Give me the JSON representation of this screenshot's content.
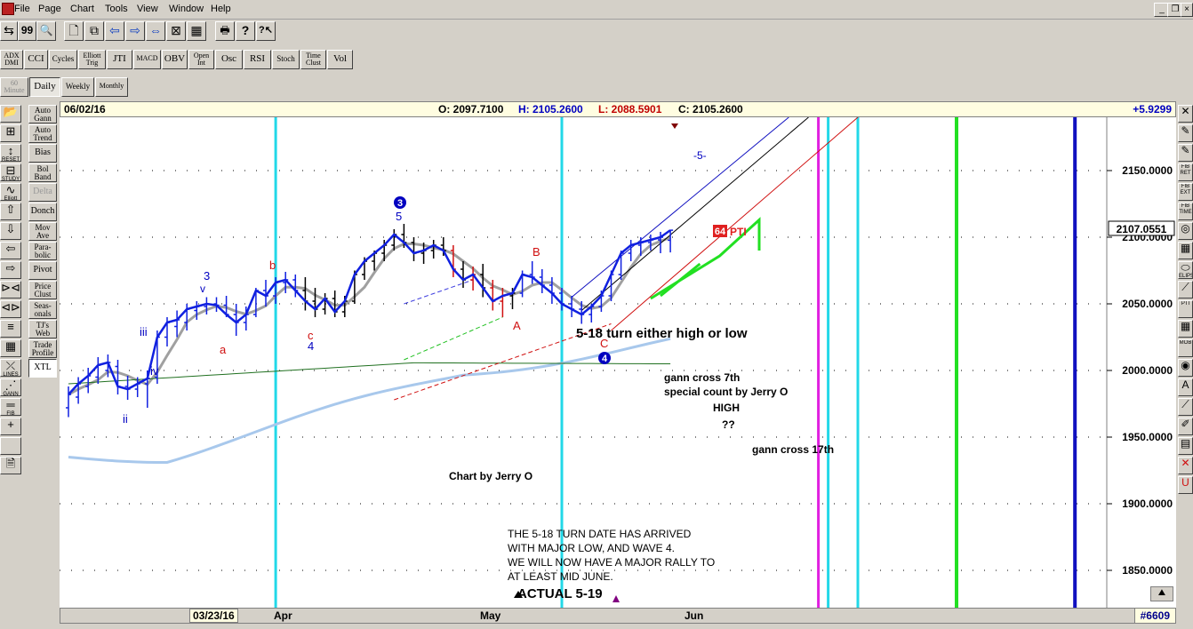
{
  "menu": [
    "File",
    "Page",
    "Chart",
    "Tools",
    "View",
    "Window",
    "Help"
  ],
  "window_controls": [
    "_",
    "❐",
    "×"
  ],
  "toolbar_row1": [
    "⇆",
    "99",
    "🔍",
    "🗋",
    "⧉",
    "⇦",
    "⇨",
    "⇔",
    "⊠",
    "▦",
    "🖶",
    "?",
    "?↖"
  ],
  "toolbar_row2": [
    {
      "name": "adx-dmi",
      "label": "ADX DMI"
    },
    {
      "name": "cci",
      "label": "CCI"
    },
    {
      "name": "cycles",
      "label": "Cycles"
    },
    {
      "name": "elliott-trig",
      "label": "Elliott Trig"
    },
    {
      "name": "jti",
      "label": "JTI"
    },
    {
      "name": "macd",
      "label": "MACD"
    },
    {
      "name": "obv",
      "label": "OBV"
    },
    {
      "name": "open-int",
      "label": "Open Int"
    },
    {
      "name": "osc",
      "label": "Osc"
    },
    {
      "name": "rsi",
      "label": "RSI"
    },
    {
      "name": "stoch",
      "label": "Stoch"
    },
    {
      "name": "time-clust",
      "label": "Time Clust"
    },
    {
      "name": "vol",
      "label": "Vol"
    }
  ],
  "toolbar_row3": [
    {
      "name": "60-minute",
      "label": "60 Minute"
    },
    {
      "name": "daily",
      "label": "Daily"
    },
    {
      "name": "weekly",
      "label": "Weekly"
    },
    {
      "name": "monthly",
      "label": "Monthly"
    }
  ],
  "left_tools": [
    {
      "name": "open",
      "glyph": "📂",
      "label": ""
    },
    {
      "name": "fib-fan",
      "glyph": "⊞",
      "label": ""
    },
    {
      "name": "reset",
      "glyph": "↕",
      "label": "RESET"
    },
    {
      "name": "study",
      "glyph": "⊟",
      "label": "STUDY"
    },
    {
      "name": "elliott",
      "glyph": "∿",
      "label": "Elliott"
    },
    {
      "name": "arrow-up",
      "glyph": "⇧",
      "label": ""
    },
    {
      "name": "arrow-down",
      "glyph": "⇩",
      "label": ""
    },
    {
      "name": "arrow-left",
      "glyph": "⇦",
      "label": ""
    },
    {
      "name": "arrow-right",
      "glyph": "⇨",
      "label": ""
    },
    {
      "name": "compress",
      "glyph": "⊳⊲",
      "label": ""
    },
    {
      "name": "expand",
      "glyph": "⊲⊳",
      "label": ""
    },
    {
      "name": "bars",
      "glyph": "≡",
      "label": ""
    },
    {
      "name": "grid",
      "glyph": "▦",
      "label": ""
    },
    {
      "name": "lines",
      "glyph": "⤫",
      "label": "LINES"
    },
    {
      "name": "gann",
      "glyph": "⋰",
      "label": "GANN"
    },
    {
      "name": "fib",
      "glyph": "═",
      "label": "FIB"
    },
    {
      "name": "cross",
      "glyph": "+",
      "label": ""
    },
    {
      "name": "blank",
      "glyph": "",
      "label": ""
    },
    {
      "name": "notes",
      "glyph": "🗎",
      "label": ""
    }
  ],
  "study_tools": [
    {
      "name": "auto-gann",
      "label": "Auto Gann"
    },
    {
      "name": "auto-trend",
      "label": "Auto Trend"
    },
    {
      "name": "bias",
      "label": "Bias"
    },
    {
      "name": "bol-band",
      "label": "Bol Band"
    },
    {
      "name": "delta",
      "label": "Delta"
    },
    {
      "name": "donch",
      "label": "Donch"
    },
    {
      "name": "mov-ave",
      "label": "Mov Ave"
    },
    {
      "name": "parabolic",
      "label": "Para- bolic"
    },
    {
      "name": "pivot",
      "label": "Pivot"
    },
    {
      "name": "price-clust",
      "label": "Price Clust"
    },
    {
      "name": "seasonals",
      "label": "Seas- onals"
    },
    {
      "name": "tjs-web",
      "label": "TJ's Web"
    },
    {
      "name": "trade-profile",
      "label": "Trade Profile"
    },
    {
      "name": "xtl",
      "label": "XTL"
    }
  ],
  "right_tools": [
    {
      "name": "close-x",
      "glyph": "✕",
      "label": ""
    },
    {
      "name": "pencil",
      "glyph": "✎",
      "label": ""
    },
    {
      "name": "pencil2",
      "glyph": "✎",
      "label": ""
    },
    {
      "name": "fib-ret",
      "glyph": "",
      "label": "FIB RET"
    },
    {
      "name": "fib-ext",
      "glyph": "",
      "label": "FIB EXT"
    },
    {
      "name": "fib-time",
      "glyph": "",
      "label": "FIB TIME"
    },
    {
      "name": "fib-circle",
      "glyph": "◎",
      "label": ""
    },
    {
      "name": "grid2",
      "glyph": "▦",
      "label": ""
    },
    {
      "name": "ellipse",
      "glyph": "⬭",
      "label": "ELIPSE"
    },
    {
      "name": "diagonal",
      "glyph": "⟋",
      "label": ""
    },
    {
      "name": "pti",
      "glyph": "",
      "label": "PTI"
    },
    {
      "name": "grid3",
      "glyph": "▦",
      "label": ""
    },
    {
      "name": "mob",
      "glyph": "",
      "label": "MOB"
    },
    {
      "name": "circle-tool",
      "glyph": "◉",
      "label": ""
    },
    {
      "name": "letter-a",
      "glyph": "A",
      "label": ""
    },
    {
      "name": "wand",
      "glyph": "⟋",
      "label": ""
    },
    {
      "name": "paint",
      "glyph": "✐",
      "label": ""
    },
    {
      "name": "grid4",
      "glyph": "▤",
      "label": ""
    },
    {
      "name": "x-red",
      "glyph": "✕",
      "label": ""
    },
    {
      "name": "u-red",
      "glyph": "U",
      "label": ""
    }
  ],
  "info": {
    "date": "06/02/16",
    "open": "O: 2097.7100",
    "high": "H: 2105.2600",
    "low": "L: 2088.5901",
    "close": "C: 2105.2600",
    "change": "+5.9299"
  },
  "price_axis": {
    "ticks": [
      "2150.0000",
      "2100.0000",
      "2050.0000",
      "2000.0000",
      "1950.0000",
      "1900.0000",
      "1850.0000"
    ],
    "current": "2107.0551"
  },
  "date_axis": {
    "cursor_date": "03/23/16",
    "months": [
      "Apr",
      "May",
      "Jun"
    ],
    "count": "#6609"
  },
  "annotations": {
    "wave_labels": [
      "3",
      "v",
      "iii",
      "iv",
      "ii",
      "a",
      "b",
      "c",
      "4",
      "5",
      "B",
      "A",
      "C",
      "-5-"
    ],
    "circle_3": "3",
    "circle_4": "4",
    "pti_badge": "64",
    "pti_text": "PTI",
    "turn_text": "5-18 turn either high or low",
    "gann7": "gann cross 7th",
    "special": "special count by Jerry O",
    "high": "HIGH",
    "qq": "??",
    "gann17": "gann cross 17th",
    "chart_by": "Chart by Jerry O",
    "notes": [
      "THE 5-18 TURN DATE HAS ARRIVED",
      "WITH MAJOR LOW, AND WAVE 4.",
      "WE WILL NOW HAVE A MAJOR RALLY TO",
      "AT LEAST MID JUNE."
    ],
    "actual": "ACTUAL 5-19"
  },
  "colors": {
    "cyan_line": "#22d8e8",
    "magenta_line": "#e020e0",
    "green_line": "#22e022",
    "blue_line": "#1010c0",
    "price_blue": "#1020e0",
    "ma_gray": "#a0a0a0",
    "ma_lightblue": "#a8c8ec",
    "ma_green": "#207020",
    "red": "#d01010"
  },
  "chart_data": {
    "type": "line",
    "title": "",
    "series_name": "",
    "ylim": [
      1822,
      2190
    ],
    "x_range_bars": [
      0,
      90
    ],
    "vertical_markers_bar": {
      "cyan": [
        21,
        50,
        80,
        131
      ],
      "magenta": [
        76
      ],
      "green": [
        90
      ],
      "blue": [
        102
      ]
    },
    "price_bars": [
      [
        1972,
        1988,
        1965,
        1982
      ],
      [
        1980,
        1995,
        1975,
        1990
      ],
      [
        1988,
        2002,
        1983,
        1996
      ],
      [
        1995,
        2010,
        1990,
        2004
      ],
      [
        2000,
        2012,
        1995,
        2006
      ],
      [
        2003,
        2008,
        1982,
        1988
      ],
      [
        1988,
        1996,
        1978,
        1986
      ],
      [
        1986,
        1995,
        1980,
        1990
      ],
      [
        1990,
        2000,
        1972,
        1994
      ],
      [
        1995,
        2030,
        1990,
        2025
      ],
      [
        2025,
        2040,
        2018,
        2036
      ],
      [
        2033,
        2045,
        2025,
        2038
      ],
      [
        2036,
        2050,
        2030,
        2046
      ],
      [
        2045,
        2052,
        2038,
        2048
      ],
      [
        2048,
        2055,
        2042,
        2050
      ],
      [
        2050,
        2055,
        2044,
        2049
      ],
      [
        2049,
        2056,
        2040,
        2042
      ],
      [
        2042,
        2050,
        2026,
        2036
      ],
      [
        2036,
        2048,
        2030,
        2042
      ],
      [
        2042,
        2062,
        2040,
        2060
      ],
      [
        2060,
        2068,
        2048,
        2056
      ],
      [
        2056,
        2070,
        2050,
        2066
      ],
      [
        2066,
        2074,
        2058,
        2068
      ],
      [
        2068,
        2072,
        2055,
        2060
      ],
      [
        2060,
        2070,
        2045,
        2052
      ],
      [
        2052,
        2062,
        2040,
        2046
      ],
      [
        2046,
        2058,
        2042,
        2054
      ],
      [
        2054,
        2060,
        2040,
        2044
      ],
      [
        2044,
        2056,
        2040,
        2052
      ],
      [
        2052,
        2075,
        2050,
        2072
      ],
      [
        2072,
        2085,
        2068,
        2082
      ],
      [
        2082,
        2090,
        2075,
        2088
      ],
      [
        2088,
        2098,
        2082,
        2094
      ],
      [
        2094,
        2106,
        2090,
        2102
      ],
      [
        2102,
        2110,
        2092,
        2096
      ],
      [
        2096,
        2100,
        2082,
        2088
      ],
      [
        2088,
        2096,
        2080,
        2090
      ],
      [
        2090,
        2098,
        2084,
        2094
      ],
      [
        2094,
        2100,
        2086,
        2090
      ],
      [
        2090,
        2094,
        2070,
        2076
      ],
      [
        2076,
        2082,
        2062,
        2068
      ],
      [
        2068,
        2078,
        2060,
        2072
      ],
      [
        2072,
        2080,
        2055,
        2062
      ],
      [
        2062,
        2068,
        2045,
        2052
      ],
      [
        2052,
        2062,
        2040,
        2056
      ],
      [
        2056,
        2062,
        2046,
        2058
      ],
      [
        2058,
        2075,
        2055,
        2072
      ],
      [
        2072,
        2082,
        2065,
        2070
      ],
      [
        2070,
        2076,
        2058,
        2064
      ],
      [
        2064,
        2070,
        2050,
        2058
      ],
      [
        2058,
        2062,
        2045,
        2050
      ],
      [
        2050,
        2056,
        2040,
        2046
      ],
      [
        2046,
        2052,
        2035,
        2042
      ],
      [
        2042,
        2050,
        2036,
        2048
      ],
      [
        2048,
        2060,
        2044,
        2056
      ],
      [
        2056,
        2075,
        2052,
        2072
      ],
      [
        2072,
        2090,
        2068,
        2088
      ],
      [
        2088,
        2098,
        2082,
        2094
      ],
      [
        2094,
        2100,
        2086,
        2096
      ],
      [
        2096,
        2102,
        2090,
        2098
      ],
      [
        2098,
        2104,
        2088,
        2100
      ],
      [
        2097.71,
        2105.26,
        2088.59,
        2105.26
      ]
    ]
  }
}
